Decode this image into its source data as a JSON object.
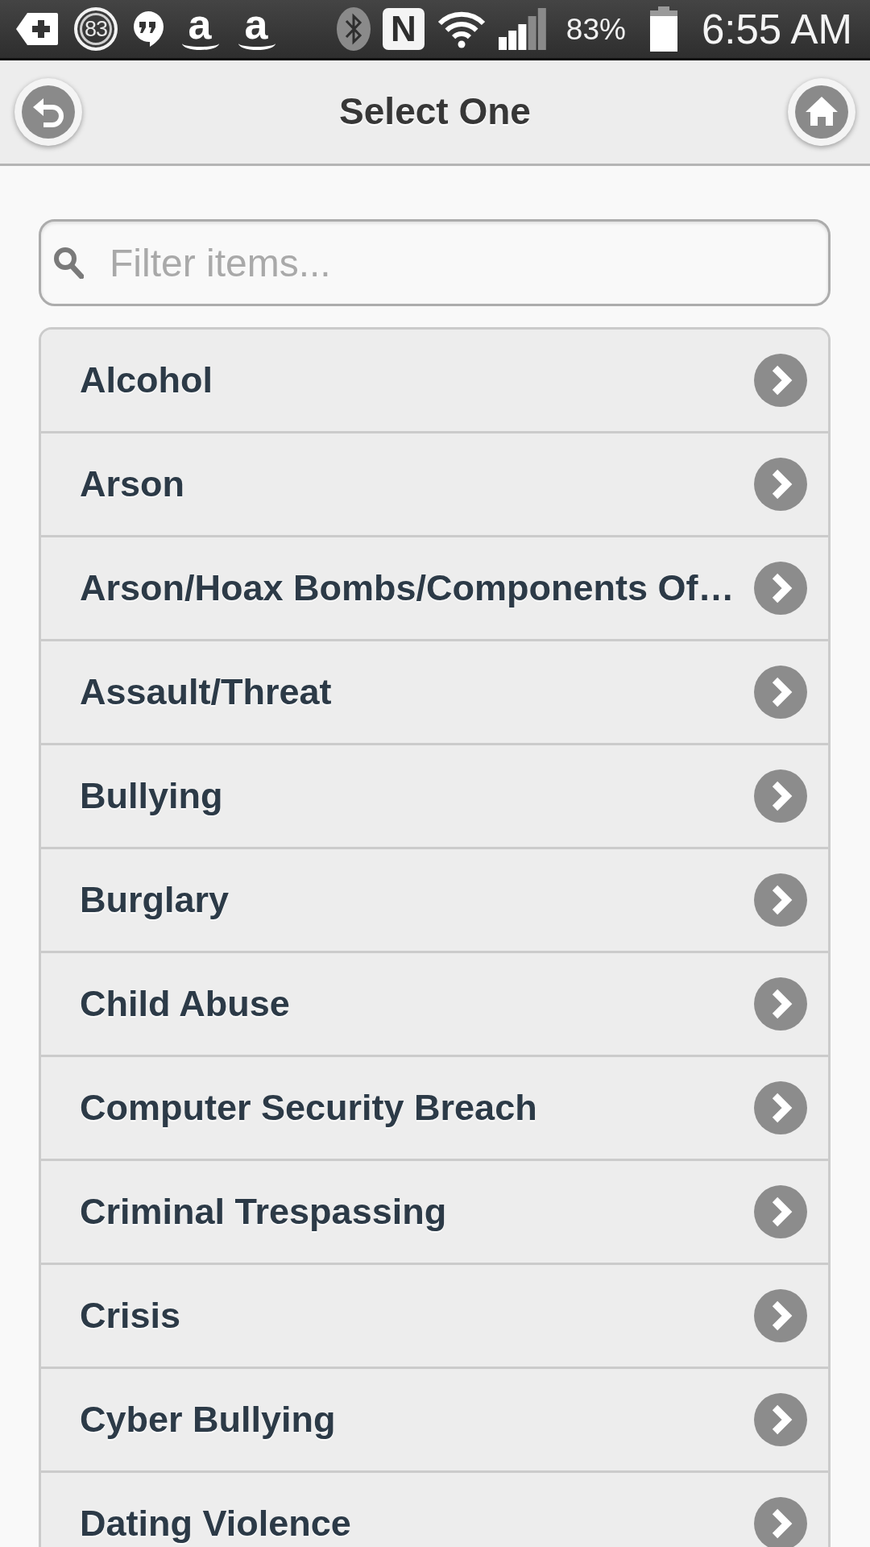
{
  "status_bar": {
    "notification_icons": [
      {
        "kind": "plus_tag"
      },
      {
        "kind": "count_badge",
        "text": "83"
      },
      {
        "kind": "quote_bubble"
      },
      {
        "kind": "smile_letter",
        "text": "a"
      },
      {
        "kind": "smile_letter",
        "text": "a"
      }
    ],
    "system_icons": [
      {
        "kind": "bluetooth"
      },
      {
        "kind": "nfc",
        "text": "N"
      },
      {
        "kind": "wifi"
      },
      {
        "kind": "signal"
      }
    ],
    "battery_percent": "83%",
    "time": "6:55 AM"
  },
  "header": {
    "title": "Select One",
    "buttons": [
      {
        "kind": "back"
      },
      {
        "kind": "home"
      }
    ]
  },
  "search": {
    "placeholder": "Filter items..."
  },
  "list": {
    "items": [
      "Alcohol",
      "Arson",
      "Arson/Hoax Bombs/Components Of…",
      "Assault/Threat",
      "Bullying",
      "Burglary",
      "Child Abuse",
      "Computer Security Breach",
      "Criminal Trespassing",
      "Crisis",
      "Cyber Bullying",
      "Dating Violence"
    ]
  }
}
